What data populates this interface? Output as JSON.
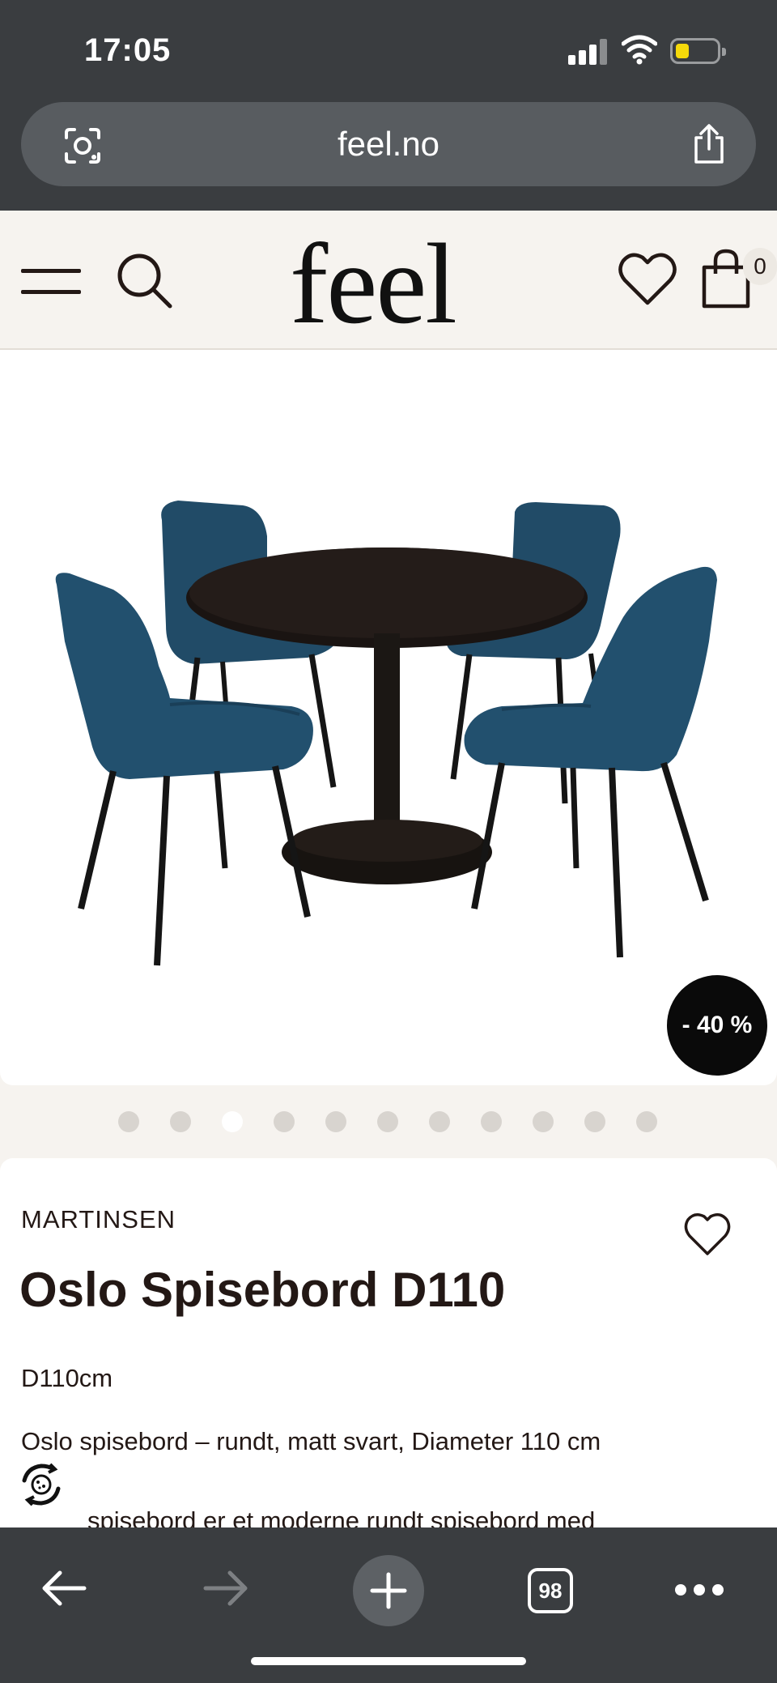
{
  "status_bar": {
    "time": "17:05"
  },
  "browser": {
    "url": "feel.no",
    "tabs_count": "98"
  },
  "site": {
    "logo": "feel",
    "cart_count": "0"
  },
  "product": {
    "discount": "- 40 %",
    "carousel": {
      "total": 11,
      "active_index": 2
    },
    "brand": "MARTINSEN",
    "title": "Oslo Spisebord D110",
    "size": "D110cm",
    "description_line1": "Oslo spisebord – rundt, matt svart, Diameter 110 cm",
    "description_line2": "spisebord er et moderne rundt spisebord med"
  },
  "colors": {
    "browser_chrome": "#3a3d40",
    "url_bar": "#585c60",
    "page_bg": "#f6f3ef",
    "text": "#231815",
    "chair_blue": "#1f4a66",
    "badge": "#0a0a0a"
  },
  "icons": {
    "menu": "hamburger-menu-icon",
    "search": "search-icon",
    "wishlist": "heart-icon",
    "cart": "shopping-bag-icon",
    "lens": "camera-lens-icon",
    "share": "share-icon",
    "back": "arrow-left-icon",
    "forward": "arrow-right-icon",
    "new_tab": "plus-icon",
    "more": "more-dots-icon",
    "cookie": "cookie-settings-icon"
  }
}
